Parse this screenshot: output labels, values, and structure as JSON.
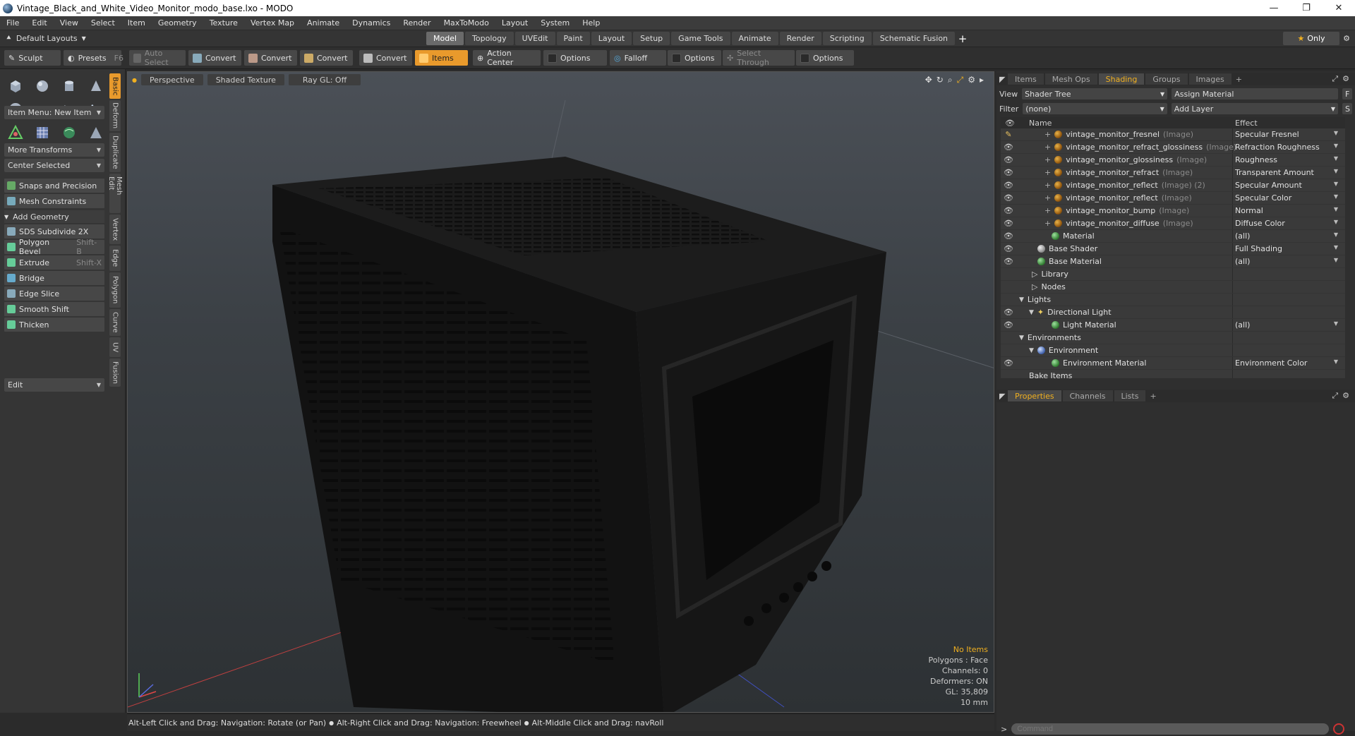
{
  "window": {
    "title": "Vintage_Black_and_White_Video_Monitor_modo_base.lxo - MODO",
    "min": "—",
    "max": "❐",
    "close": "✕"
  },
  "menu": [
    "File",
    "Edit",
    "View",
    "Select",
    "Item",
    "Geometry",
    "Texture",
    "Vertex Map",
    "Animate",
    "Dynamics",
    "Render",
    "MaxToModo",
    "Layout",
    "System",
    "Help"
  ],
  "modebar": {
    "layouts": "Default Layouts",
    "tabs": [
      "Model",
      "Topology",
      "UVEdit",
      "Paint",
      "Layout",
      "Setup",
      "Game Tools",
      "Animate",
      "Render",
      "Scripting",
      "Schematic Fusion"
    ],
    "active_tab": "Model",
    "plus": "+",
    "only": "Only"
  },
  "toolbar": {
    "sculpt": "Sculpt",
    "presets": "Presets",
    "presets_key": "F6",
    "auto_select": "Auto Select",
    "convert1": "Convert",
    "convert2": "Convert",
    "convert3": "Convert",
    "convert4": "Convert",
    "items": "Items",
    "action_center": "Action Center",
    "options1": "Options",
    "falloff": "Falloff",
    "options2": "Options",
    "select_through": "Select Through",
    "options3": "Options"
  },
  "left": {
    "item_menu": "Item Menu: New Item",
    "more_transforms": "More Transforms",
    "center_selected": "Center Selected",
    "snaps": "Snaps and Precision",
    "mesh_constraints": "Mesh Constraints",
    "add_geometry": "Add Geometry",
    "tools": [
      {
        "label": "SDS Subdivide 2X",
        "key": ""
      },
      {
        "label": "Polygon Bevel",
        "key": "Shift-B"
      },
      {
        "label": "Extrude",
        "key": "Shift-X"
      },
      {
        "label": "Bridge",
        "key": ""
      },
      {
        "label": "Edge Slice",
        "key": ""
      },
      {
        "label": "Smooth Shift",
        "key": ""
      },
      {
        "label": "Thicken",
        "key": ""
      }
    ],
    "edit": "Edit",
    "sidetabs": [
      "Basic",
      "Deform",
      "Duplicate",
      "Mesh Edit",
      "Vertex",
      "Edge",
      "Polygon",
      "Curve",
      "UV",
      "Fusion"
    ]
  },
  "viewport": {
    "perspective": "Perspective",
    "shaded": "Shaded Texture",
    "raygl": "Ray GL: Off",
    "info": {
      "no_items": "No Items",
      "polygons": "Polygons : Face",
      "channels": "Channels: 0",
      "deformers": "Deformers: ON",
      "gl": "GL: 35,809",
      "scale": "10 mm"
    }
  },
  "status": {
    "hint1": "Alt-Left Click and Drag: Navigation: Rotate (or Pan)",
    "hint2": "Alt-Right Click and Drag: Navigation: Freewheel",
    "hint3": "Alt-Middle Click and Drag: navRoll"
  },
  "right": {
    "tabs": [
      "Items",
      "Mesh Ops",
      "Shading",
      "Groups",
      "Images"
    ],
    "active_tab": "Shading",
    "view_label": "View",
    "view_value": "Shader Tree",
    "assign": "Assign Material",
    "f": "F",
    "filter_label": "Filter",
    "filter_value": "(none)",
    "add_layer": "Add Layer",
    "s": "S",
    "col_name": "Name",
    "col_effect": "Effect",
    "rows": [
      {
        "name": "vintage_monitor_fresnel",
        "sub": "(Image)",
        "effect": "Specular Fresnel"
      },
      {
        "name": "vintage_monitor_refract_glossiness",
        "sub": "(Image)",
        "effect": "Refraction Roughness"
      },
      {
        "name": "vintage_monitor_glossiness",
        "sub": "(Image)",
        "effect": "Roughness"
      },
      {
        "name": "vintage_monitor_refract",
        "sub": "(Image)",
        "effect": "Transparent Amount"
      },
      {
        "name": "vintage_monitor_reflect",
        "sub": "(Image) (2)",
        "effect": "Specular Amount"
      },
      {
        "name": "vintage_monitor_reflect",
        "sub": "(Image)",
        "effect": "Specular Color"
      },
      {
        "name": "vintage_monitor_bump",
        "sub": "(Image)",
        "effect": "Normal"
      },
      {
        "name": "vintage_monitor_diffuse",
        "sub": "(Image)",
        "effect": "Diffuse Color"
      },
      {
        "name": "Material",
        "sub": "",
        "effect": "(all)"
      },
      {
        "name": "Base Shader",
        "sub": "",
        "effect": "Full Shading"
      },
      {
        "name": "Base Material",
        "sub": "",
        "effect": "(all)"
      },
      {
        "name": "Library",
        "sub": "",
        "effect": ""
      },
      {
        "name": "Nodes",
        "sub": "",
        "effect": ""
      },
      {
        "name": "Lights",
        "sub": "",
        "effect": ""
      },
      {
        "name": "Directional Light",
        "sub": "",
        "effect": ""
      },
      {
        "name": "Light Material",
        "sub": "",
        "effect": "(all)"
      },
      {
        "name": "Environments",
        "sub": "",
        "effect": ""
      },
      {
        "name": "Environment",
        "sub": "",
        "effect": ""
      },
      {
        "name": "Environment Material",
        "sub": "",
        "effect": "Environment Color"
      },
      {
        "name": "Bake Items",
        "sub": "",
        "effect": ""
      }
    ],
    "lower_tabs": [
      "Properties",
      "Channels",
      "Lists"
    ],
    "lower_active": "Properties",
    "command_placeholder": "Command"
  }
}
